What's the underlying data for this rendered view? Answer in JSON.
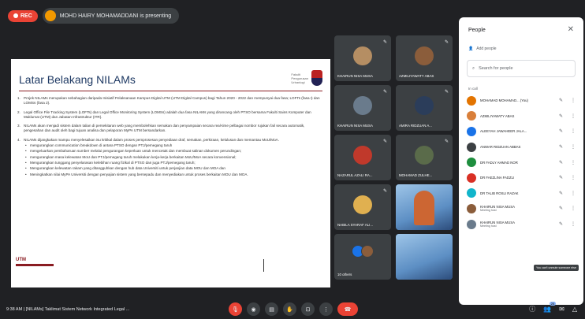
{
  "topbar": {
    "rec_label": "REC",
    "presenter_text": "MOHD HAIRY MOHAMADDANI is presenting"
  },
  "slide": {
    "title": "Latar Belakang NILAMs",
    "logo_text": "Fakulti\nPengurusan\nUrbanlogi",
    "paragraphs": [
      {
        "num": "1.",
        "text": "Projek NILAMs merupakan sebahagian daripada Inisiatif Pelaksanaan Kampus Digital UTM (UTM Digital Campus) bagi Tahun 2020 - 2022 dan mempunyai dua fasa; LOFTs (fasa I) dan LOMSs (fasa 2)."
      },
      {
        "num": "2.",
        "text": "Legal Office File Tracking System (LOFTs) dan Legal Office Monitoring System (LOMSs) adalah dua fasa NILAMs yang dirancang oleh PTSO bersama Fakulti Sains Komputer dan Maklumat (UTM) dan Jabatan Infrastruktur (ITR)."
      },
      {
        "num": "3.",
        "text": "NILAMs akan menjadi sistem dalam talian di persekitaran web yang membolehkan semakan dan penyampaian secara real-time pelbagai nombor rujukan fail secara automatik, pengesahan dan audit oleh bagi tujuan analisa dan pelaporan MyPA UTM bersandarkan."
      },
      {
        "num": "4.",
        "text": "NILAMs dijangkakan mampu menyelesaikan isu kritikal dalam proses pemprosesan penyediaan draf, semakan, perkiraan, kelulusan dan memantau MoU/MoA."
      }
    ],
    "bullets": [
      "mengurangkan communication breakdown di antara PTSO dengan PTJ/pemegang taruh",
      "mengeluarkan pembaharuan sumber melalui pengurangan keperluan untuk mencetak dan membuat salinan dokumen perundingan;",
      "mengurangkan masa kelewatan MoU dan PTJ/pemegang taruh melakukan kerja-kerja berkaitan MoU/MoA secara konvensional;",
      "Mengurangkan tunggang penyelarasan kelebihan ruang fizikal di PTSO dan juga PTJ/pemegang taruh;",
      "Mengurangkan kelewatan rakam yang ditangguhkan dengan hub data Universiti untuk perjanjian data MOU dan MOA dan",
      "Meningkatkan nilai MyPA Universiti dengan penyajian sistem yang bersepadu dan menyediakan untuk proses berkaitan MOU dan MOA."
    ],
    "footer_logo": "UTM"
  },
  "tiles": [
    {
      "name": "KHAIRUN NISA MUSA",
      "color": "#b58e63"
    },
    {
      "name": "AZMILIYAWATY ABAS",
      "color": "#8b5d3b"
    },
    {
      "name": "KHAIRUN NISA MUSA",
      "color": "#6a7b8c"
    },
    {
      "name": "AMIRA RIDZUAN A...",
      "color": "#2b3d5a"
    },
    {
      "name": "NAZARUL AZALI RA...",
      "color": "#c0392b"
    },
    {
      "name": "MOHAMAD ZULHE...",
      "color": "#5a6b4a"
    },
    {
      "name": "NABILA SYARAF ALI...",
      "color": "#e0b050"
    },
    {
      "name": "",
      "color": "#4a7fb0"
    },
    {
      "name": "10 others",
      "color": "#3c4043"
    }
  ],
  "people": {
    "title": "People",
    "add_label": "Add people",
    "search_placeholder": "Search for people",
    "section_label": "In call",
    "rows": [
      {
        "name": "MOHAMAD MOHAMAD...",
        "sub": "",
        "role": "(You)",
        "color": "#e37400"
      },
      {
        "name": "AZMILIYAWATY ABAS",
        "sub": "",
        "color": "#d97f3a"
      },
      {
        "name": "ALEEYAH JAWAHEER JALA...",
        "sub": "",
        "color": "#1a73e8"
      },
      {
        "name": "ANWAR RIDZUAN ABBAS",
        "sub": "",
        "color": "#3c4043"
      },
      {
        "name": "DR FADLY AHMAD NOR",
        "sub": "",
        "color": "#1e8e3e"
      },
      {
        "name": "DR FAEZLINA FADZLI",
        "sub": "",
        "color": "#d93025"
      },
      {
        "name": "DR TALIB ROSLI RAZAK",
        "sub": "",
        "color": "#12b5cb"
      },
      {
        "name": "KHAIRUN NISA MUSA",
        "sub": "Meeting host",
        "color": "#8b5d3b"
      },
      {
        "name": "KHAIRUN NISA MUSA",
        "sub": "Meeting host",
        "color": "#6a7b8c"
      }
    ],
    "tooltip": "You can't unmute someone else"
  },
  "bottombar": {
    "meeting_info": "9:38 AM  |  [NILAMs] Taklimat Sistem Network Integrated Legal ...",
    "people_count": "26"
  }
}
